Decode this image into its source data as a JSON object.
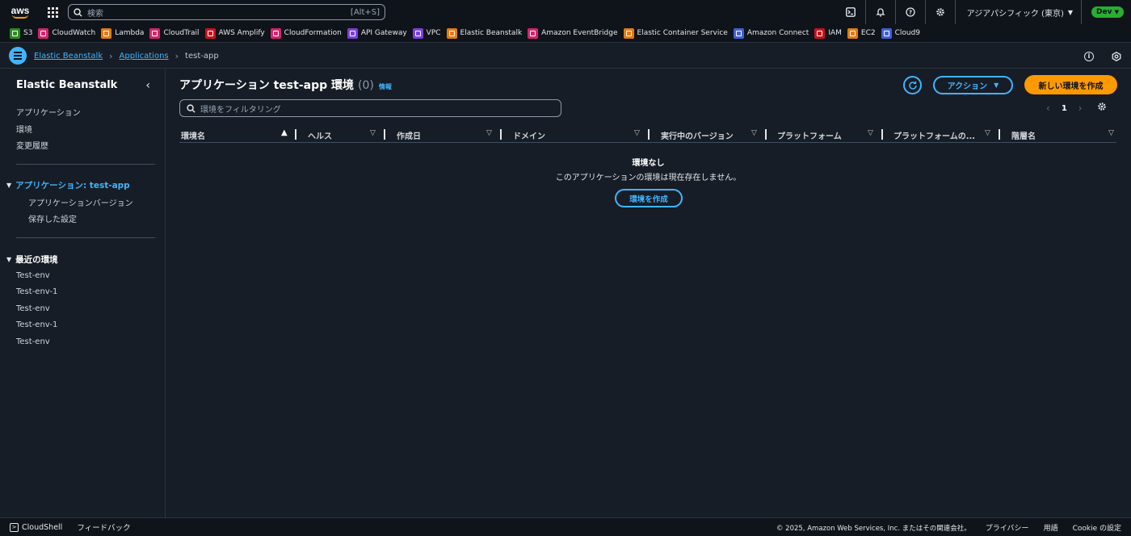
{
  "topnav": {
    "logo": "aws",
    "search_placeholder": "検索",
    "search_shortcut": "[Alt+S]",
    "region": "アジアパシフィック (東京)",
    "account_badge": "Dev"
  },
  "favorites": [
    {
      "label": "S3",
      "color": "#2e8b1f"
    },
    {
      "label": "CloudWatch",
      "color": "#d6246e"
    },
    {
      "label": "Lambda",
      "color": "#e8790c"
    },
    {
      "label": "CloudTrail",
      "color": "#d6246e"
    },
    {
      "label": "AWS Amplify",
      "color": "#c7131f"
    },
    {
      "label": "CloudFormation",
      "color": "#d6246e"
    },
    {
      "label": "API Gateway",
      "color": "#7b3fe4"
    },
    {
      "label": "VPC",
      "color": "#7b3fe4"
    },
    {
      "label": "Elastic Beanstalk",
      "color": "#e8790c"
    },
    {
      "label": "Amazon EventBridge",
      "color": "#d6246e"
    },
    {
      "label": "Elastic Container Service",
      "color": "#e8790c"
    },
    {
      "label": "Amazon Connect",
      "color": "#4160d8"
    },
    {
      "label": "IAM",
      "color": "#c7131f"
    },
    {
      "label": "EC2",
      "color": "#e8790c"
    },
    {
      "label": "Cloud9",
      "color": "#4160d8"
    }
  ],
  "breadcrumb": {
    "service": "Elastic Beanstalk",
    "applications": "Applications",
    "current": "test-app"
  },
  "sidebar": {
    "title": "Elastic Beanstalk",
    "links": [
      "アプリケーション",
      "環境",
      "変更履歴"
    ],
    "app_section": "アプリケーション: test-app",
    "app_sub": [
      "アプリケーションバージョン",
      "保存した設定"
    ],
    "recent_section": "最近の環境",
    "recent": [
      "Test-env",
      "Test-env-1",
      "Test-env",
      "Test-env-1",
      "Test-env"
    ]
  },
  "main": {
    "title": "アプリケーション test-app 環境",
    "count": "(0)",
    "info": "情報",
    "actions_label": "アクション",
    "primary_label": "新しい環境を作成",
    "filter_placeholder": "環境をフィルタリング",
    "page": "1",
    "columns": [
      "環境名",
      "ヘルス",
      "作成日",
      "ドメイン",
      "実行中のバージョン",
      "プラットフォーム",
      "プラットフォームの...",
      "階層名"
    ],
    "empty_title": "環境なし",
    "empty_message": "このアプリケーションの環境は現在存在しません。",
    "create_label": "環境を作成"
  },
  "footer": {
    "cloudshell": "CloudShell",
    "feedback": "フィードバック",
    "copyright": "© 2025, Amazon Web Services, Inc. またはその関連会社。",
    "privacy": "プライバシー",
    "terms": "用語",
    "cookie": "Cookie の設定"
  },
  "colors": {
    "accent": "#42b4ff",
    "primary": "#ff9900",
    "badge": "#29ad32"
  }
}
